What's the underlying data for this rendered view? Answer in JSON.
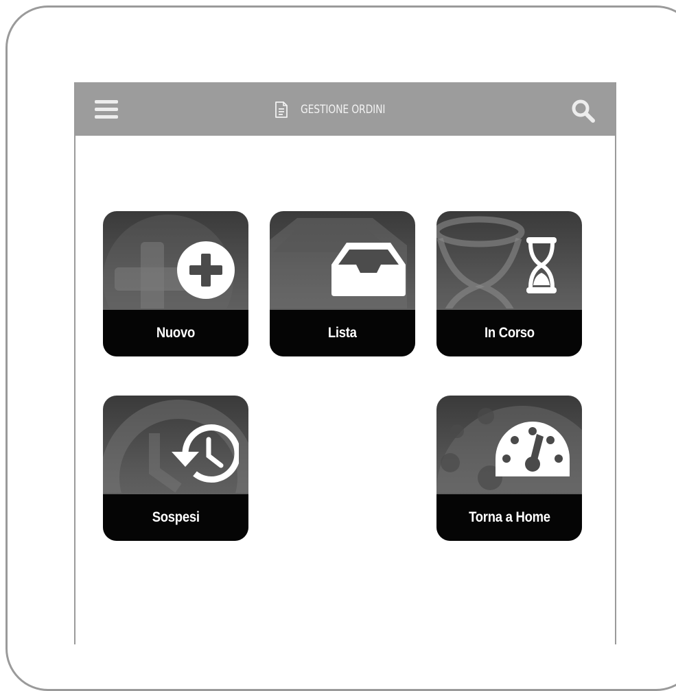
{
  "header": {
    "title": "GESTIONE ORDINI",
    "menu_icon": "hamburger-menu-icon",
    "title_icon": "document-icon",
    "search_icon": "search-icon",
    "bar_color": "#9c9c9c"
  },
  "tiles": [
    {
      "label": "Nuovo",
      "icon": "plus-circle-icon"
    },
    {
      "label": "Lista",
      "icon": "inbox-tray-icon"
    },
    {
      "label": "In Corso",
      "icon": "hourglass-icon"
    },
    {
      "label": "Sospesi",
      "icon": "history-clock-icon"
    },
    {
      "label": "Torna a Home",
      "icon": "speedometer-icon"
    }
  ]
}
